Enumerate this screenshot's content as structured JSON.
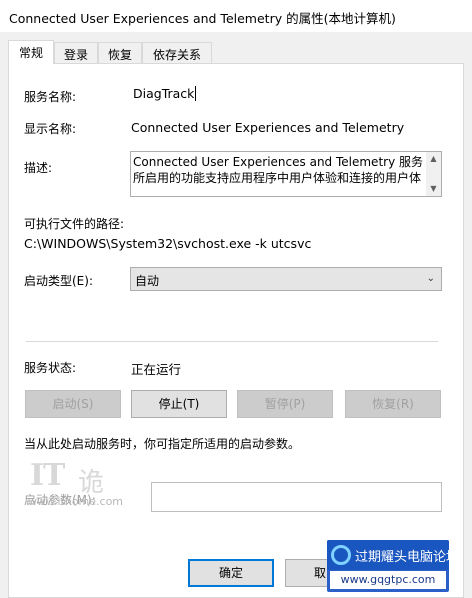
{
  "window": {
    "title": "Connected User Experiences and Telemetry 的属性(本地计算机)"
  },
  "tabs": [
    {
      "label": "常规",
      "active": true
    },
    {
      "label": "登录",
      "active": false
    },
    {
      "label": "恢复",
      "active": false
    },
    {
      "label": "依存关系",
      "active": false
    }
  ],
  "general": {
    "service_name_label": "服务名称:",
    "service_name_value": "DiagTrack",
    "display_name_label": "显示名称:",
    "display_name_value": "Connected User Experiences and Telemetry",
    "description_label": "描述:",
    "description_value": "Connected User Experiences and Telemetry 服务所启用的功能支持应用程序中用户体验和连接的用户体",
    "exe_path_label": "可执行文件的路径:",
    "exe_path_value": "C:\\WINDOWS\\System32\\svchost.exe -k utcsvc",
    "startup_type_label": "启动类型(E):",
    "startup_type_value": "自动",
    "status_label": "服务状态:",
    "status_value": "正在运行",
    "buttons": {
      "start": "启动(S)",
      "stop": "停止(T)",
      "pause": "暂停(P)",
      "resume": "恢复(R)"
    },
    "hint": "当从此处启动服务时，你可指定所适用的启动参数。",
    "start_params_label": "启动参数(M):",
    "start_params_value": ""
  },
  "dialog_buttons": {
    "ok": "确定",
    "cancel": "取"
  },
  "watermarks": {
    "ithome_logo": "IT之家",
    "ithome_url": "www.ithome.com",
    "forum_title": "过期耀头电脑论坛",
    "forum_url": "www.gqgtpc.com"
  }
}
